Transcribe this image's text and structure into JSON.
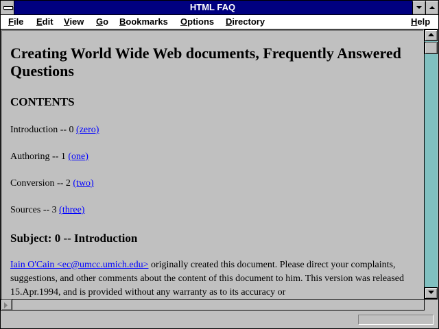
{
  "window": {
    "title": "HTML FAQ"
  },
  "menubar": {
    "items": [
      {
        "label": "File",
        "u": "F",
        "rest": "ile"
      },
      {
        "label": "Edit",
        "u": "E",
        "rest": "dit"
      },
      {
        "label": "View",
        "u": "V",
        "rest": "iew"
      },
      {
        "label": "Go",
        "u": "G",
        "rest": "o"
      },
      {
        "label": "Bookmarks",
        "u": "B",
        "rest": "ookmarks"
      },
      {
        "label": "Options",
        "u": "O",
        "rest": "ptions"
      },
      {
        "label": "Directory",
        "u": "D",
        "rest": "irectory"
      },
      {
        "label": "Help",
        "u": "H",
        "rest": "elp"
      }
    ]
  },
  "document": {
    "heading": "Creating World Wide Web documents, Frequently Answered Questions",
    "contents_heading": "CONTENTS",
    "toc": [
      {
        "text": "Introduction -- 0 ",
        "link": "(zero)"
      },
      {
        "text": "Authoring -- 1 ",
        "link": "(one)"
      },
      {
        "text": "Conversion -- 2 ",
        "link": "(two)"
      },
      {
        "text": "Sources -- 3 ",
        "link": "(three)"
      }
    ],
    "subject": {
      "prefix": "Subject: 0",
      "dash": " -- ",
      "title": "Introduction"
    },
    "intro": {
      "author_link": "Iain O'Cain <ec@umcc.umich.edu>",
      "text": " originally created this document. Please direct your complaints, suggestions, and other comments about the content of this document to him. This version was released 15.Apr.1994, and is provided without any warranty as to its accuracy or"
    }
  },
  "colors": {
    "titlebar": "#000080",
    "background": "#c0c0c0",
    "link": "#0000ff",
    "scroll_track": "#80c0c0"
  }
}
